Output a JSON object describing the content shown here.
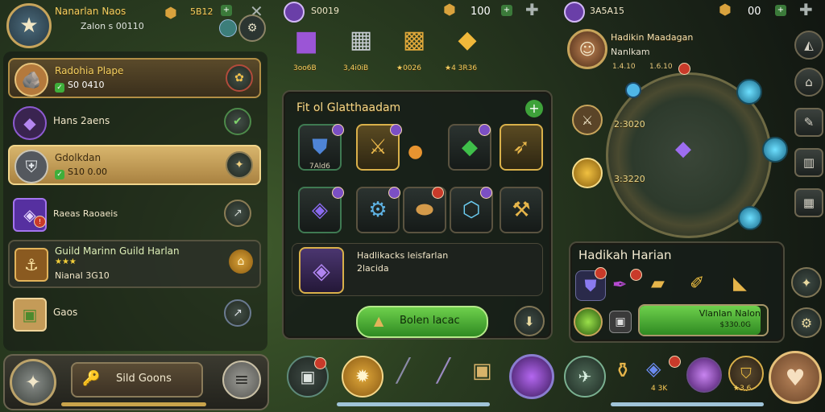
{
  "left_header": {
    "title": "Nanarlan Naos",
    "subtitle": "Zalon s 00110",
    "gold": "5B12"
  },
  "mid_header": {
    "gems": "S0019",
    "gold": "100"
  },
  "right_header": {
    "gems": "3A5A15",
    "gold": "00"
  },
  "guild_list": [
    {
      "title": "Radohia Plape",
      "sub": "S0 0410",
      "state": "selected-light",
      "checked": true,
      "icon": "rock-icon"
    },
    {
      "title": "Hans 2aens",
      "sub": "",
      "state": "plain",
      "checked": false,
      "icon": "amethyst-icon"
    },
    {
      "title": "Gdolkdan",
      "sub": "S10 0.00",
      "state": "selected",
      "checked": true,
      "icon": "armor-icon"
    },
    {
      "title": "Raeas Raoaeis",
      "sub": "",
      "state": "plain",
      "checked": false,
      "icon": "crystal-icon"
    },
    {
      "title": "Guild Marinn Guild Harlan",
      "sub": "Nianal 3G10",
      "state": "dim",
      "checked": false,
      "icon": "ship-icon",
      "stars": "★★★"
    },
    {
      "title": "Gaos",
      "sub": "",
      "state": "plain",
      "checked": false,
      "icon": "crate-icon"
    }
  ],
  "bottom_left": {
    "button_label": "Sild Goons"
  },
  "mid_top_items": [
    {
      "label": "3oo6B",
      "icon": "purple-chest-icon"
    },
    {
      "label": "3,4i0iB",
      "icon": "silver-chest-icon"
    },
    {
      "label": "★0026",
      "icon": "gold-chest-icon"
    },
    {
      "label": "★4 3R36",
      "icon": "gold-crate-icon"
    }
  ],
  "craft_panel": {
    "title": "Fit ol Glatthaadam",
    "item_caption": "7Ald6",
    "detail_title": "Hadlikacks leisfarlan",
    "detail_sub": "2lacida",
    "action_label": "Bolen lacac"
  },
  "right_panel": {
    "avatar_name": "Hadikin Maadagan",
    "avatar_sub": "Nanlkam",
    "avatar_stats": [
      "1.4.10",
      "1.6.10"
    ],
    "map_labels": [
      "2:3020",
      "3:3220"
    ],
    "hero_title": "Hadikah Harian",
    "bar_label": "Vlanlan Nalon",
    "bar_value": "$330.0G",
    "bar_fill": 0.95
  },
  "bottom_mid_counts": {
    "gold_count": "4 3K",
    "item_count": "★3.6"
  }
}
